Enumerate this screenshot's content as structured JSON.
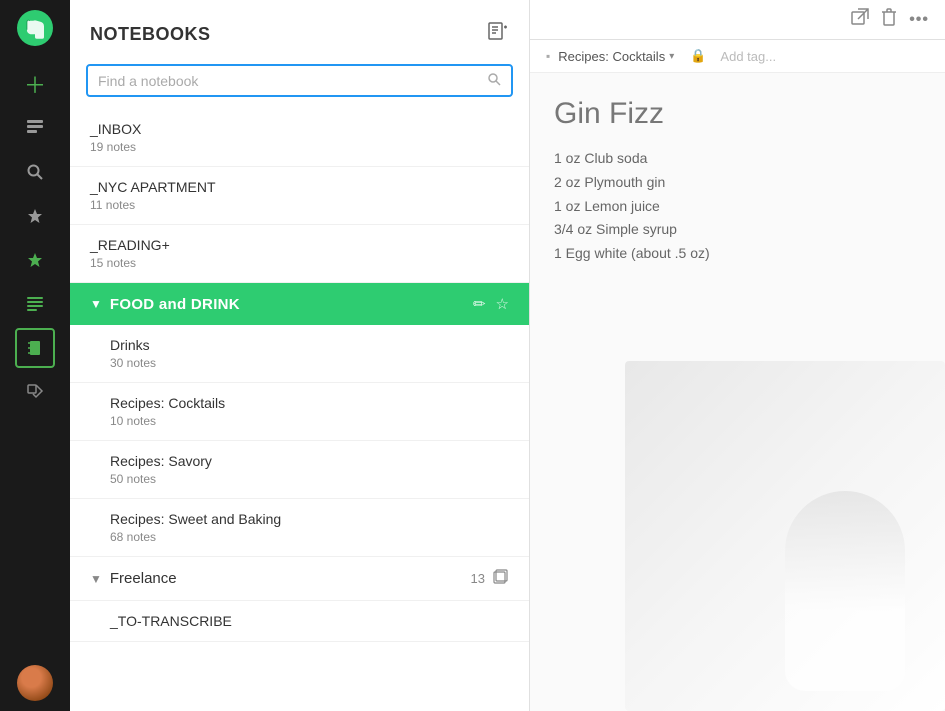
{
  "app": {
    "name": "Evernote"
  },
  "sidebar": {
    "icons": [
      {
        "name": "new-note-icon",
        "glyph": "＋",
        "active": false
      },
      {
        "name": "notes-icon",
        "glyph": "📋",
        "active": false
      },
      {
        "name": "search-nav-icon",
        "glyph": "🔍",
        "active": false
      },
      {
        "name": "chat-icon",
        "glyph": "💬",
        "active": false
      },
      {
        "name": "star-icon",
        "glyph": "★",
        "active": false
      },
      {
        "name": "note-list-icon",
        "glyph": "📄",
        "active": false
      },
      {
        "name": "notebook-icon",
        "glyph": "📓",
        "active": false
      },
      {
        "name": "tag-icon",
        "glyph": "🏷",
        "active": false
      }
    ]
  },
  "notebooks_panel": {
    "title": "NOTEBOOKS",
    "search_placeholder": "Find a notebook",
    "add_notebook_icon": "⊞",
    "items": [
      {
        "name": "_INBOX",
        "count": "19 notes"
      },
      {
        "name": "_NYC APARTMENT",
        "count": "11 notes"
      },
      {
        "name": "_READING+",
        "count": "15 notes"
      }
    ],
    "stacks": [
      {
        "name": "FOOD and DRINK",
        "expanded": true,
        "children": [
          {
            "name": "Drinks",
            "count": "30 notes"
          },
          {
            "name": "Recipes: Cocktails",
            "count": "10 notes"
          },
          {
            "name": "Recipes: Savory",
            "count": "50 notes"
          },
          {
            "name": "Recipes: Sweet and Baking",
            "count": "68 notes"
          }
        ]
      },
      {
        "name": "Freelance",
        "expanded": true,
        "count": "13",
        "children": [
          {
            "name": "_TO-TRANSCRIBE",
            "count": ""
          }
        ]
      }
    ]
  },
  "note_editor": {
    "toolbar": {
      "share_icon": "↗",
      "delete_icon": "🗑",
      "more_icon": "•••"
    },
    "meta": {
      "notebook_label": "Recipes: Cocktails",
      "tag_placeholder": "Add tag..."
    },
    "title": "Gin Fizz",
    "body_lines": [
      "1 oz Club soda",
      "2 oz Plymouth gin",
      "1 oz Lemon juice",
      "3/4 oz Simple syrup",
      "1 Egg white (about .5 oz)"
    ]
  }
}
